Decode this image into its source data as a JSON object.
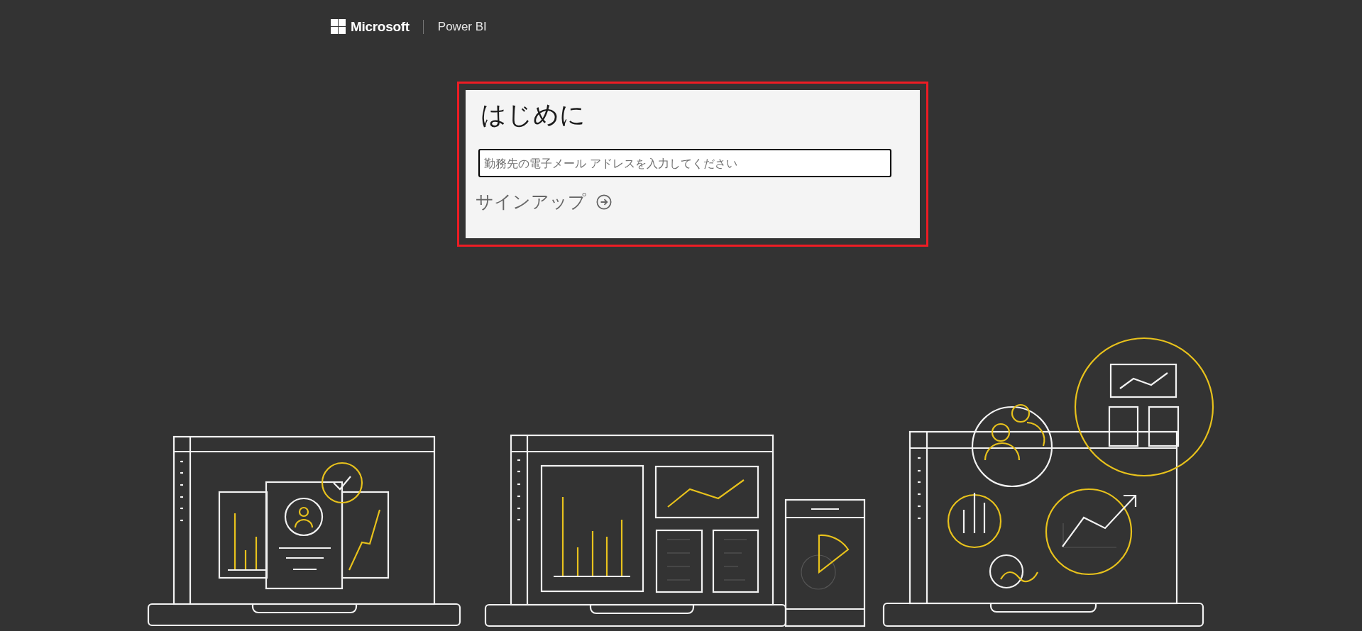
{
  "header": {
    "brand": "Microsoft",
    "product": "Power BI"
  },
  "signup_form": {
    "highlighted": true,
    "title": "はじめに",
    "email_field": {
      "placeholder": "勤務先の電子メール アドレスを入力してください"
    },
    "signup_button": "サインアップ"
  }
}
